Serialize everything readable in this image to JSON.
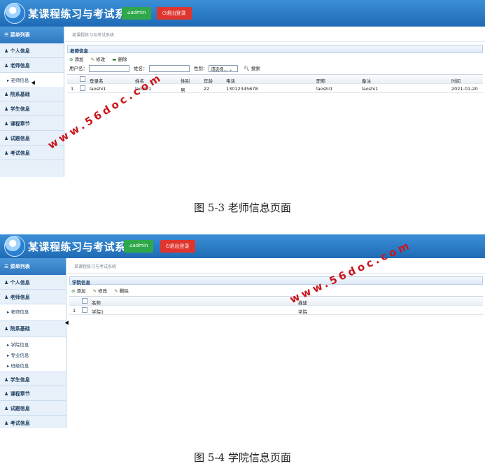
{
  "app": {
    "title": "某课程练习与考试系统",
    "admin_label": "admin",
    "logout_label": "退出登录"
  },
  "menu_head": "菜单列表",
  "screenshot1": {
    "menu": [
      "个人信息",
      "老师信息",
      "老师信息",
      "院系基础",
      "学生信息",
      "课程章节",
      "试题信息",
      "考试信息"
    ],
    "breadcrumb": "某课程练习与考试系统",
    "panel_title": "老师信息",
    "toolbar": {
      "add": "添加",
      "edit": "修改",
      "delete": "删除"
    },
    "filters": {
      "username_label": "用户名：",
      "name_label": "姓名：",
      "gender_label": "性别：",
      "gender_select": "请选择...",
      "search_label": "搜索"
    },
    "columns": [
      "登录名",
      "姓名",
      "性别",
      "年龄",
      "电话",
      "职称",
      "备注",
      "时间"
    ],
    "rows": [
      {
        "index": "1",
        "cells": [
          "laoshi1",
          "laoshi1",
          "男",
          "22",
          "13012345678",
          "laoshi1",
          "laoshi1",
          "2021-01-20"
        ]
      }
    ]
  },
  "caption1": "图 5-3 老师信息页面",
  "screenshot2": {
    "menu_top": [
      "个人信息",
      "老师信息"
    ],
    "menu_sub1": [
      "老师信息"
    ],
    "menu_mid": [
      "院系基础"
    ],
    "menu_sub2": [
      "学院信息",
      "专业信息",
      "班级信息"
    ],
    "menu_bottom": [
      "学生信息",
      "课程章节",
      "试题信息",
      "考试信息"
    ],
    "breadcrumb": "某课程练习与考试系统",
    "panel_title": "学院信息",
    "toolbar": {
      "add": "添加",
      "edit": "修改",
      "delete": "删除"
    },
    "columns": [
      "名称",
      "描述"
    ],
    "rows": [
      {
        "index": "1",
        "cells": [
          "学院1",
          "学院"
        ]
      }
    ]
  },
  "caption2": "图 5-4 学院信息页面",
  "watermark": "www.56doc.com"
}
